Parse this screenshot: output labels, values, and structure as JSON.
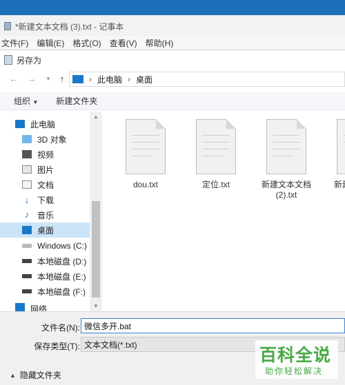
{
  "notepad": {
    "title": "*新建文本文档 (3).txt - 记事本",
    "menu": [
      "文件(F)",
      "编辑(E)",
      "格式(O)",
      "查看(V)",
      "帮助(H)"
    ]
  },
  "dialog": {
    "title": "另存为",
    "address": {
      "root": "此电脑",
      "current": "桌面"
    },
    "toolbar": {
      "organize": "组织",
      "new_folder": "新建文件夹"
    },
    "nav": [
      {
        "label": "此电脑",
        "icon": "computer-icon"
      },
      {
        "label": "3D 对象",
        "icon": "3d-objects-icon"
      },
      {
        "label": "视频",
        "icon": "video-icon"
      },
      {
        "label": "图片",
        "icon": "pictures-icon"
      },
      {
        "label": "文档",
        "icon": "documents-icon"
      },
      {
        "label": "下载",
        "icon": "download-icon"
      },
      {
        "label": "音乐",
        "icon": "music-icon"
      },
      {
        "label": "桌面",
        "icon": "desktop-icon",
        "selected": true
      },
      {
        "label": "Windows (C:)",
        "icon": "drive-icon"
      },
      {
        "label": "本地磁盘 (D:)",
        "icon": "drive-icon"
      },
      {
        "label": "本地磁盘 (E:)",
        "icon": "drive-icon"
      },
      {
        "label": "本地磁盘 (F:)",
        "icon": "drive-icon"
      },
      {
        "label": "网络",
        "icon": "network-icon"
      }
    ],
    "files": [
      {
        "name": "dou.txt"
      },
      {
        "name": "定位.txt"
      },
      {
        "name": "新建文本文档 (2).txt"
      },
      {
        "name": "新建"
      }
    ],
    "form": {
      "filename_label": "文件名(N):",
      "filename_value": "微信多开.bat",
      "filetype_label": "保存类型(T):",
      "filetype_value": "文本文档(*.txt)"
    },
    "hide_folders": "隐藏文件夹"
  },
  "watermark": {
    "big": "百科全说",
    "small": "助你轻松解决"
  },
  "colors": {
    "selection": "#cce4f7",
    "desktop_icon": "#1a78c8",
    "watermark": "#3aa537"
  }
}
